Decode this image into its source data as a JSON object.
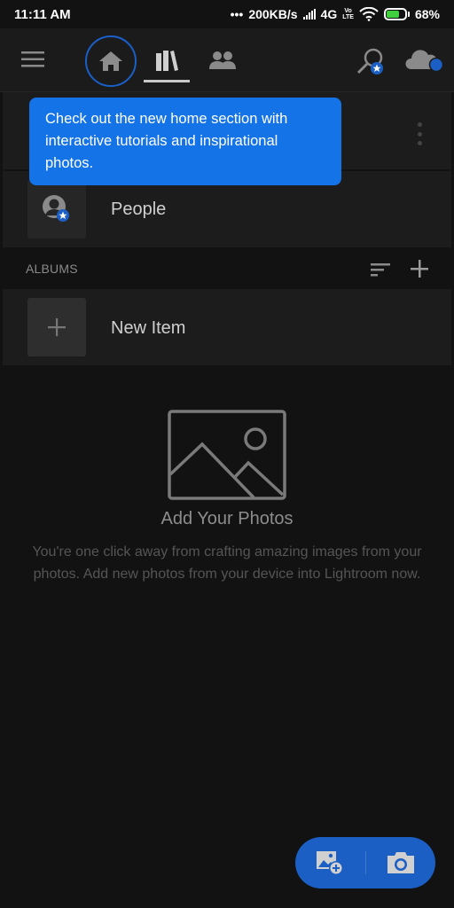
{
  "status_bar": {
    "time": "11:11 AM",
    "dots": "•••",
    "network_speed": "200KB/s",
    "network_type": "4G",
    "volte_top": "Vo",
    "volte_bottom": "LTE",
    "battery_percent": "68%",
    "battery_level": 0.68
  },
  "topbar": {
    "icons": [
      "menu-icon",
      "home-icon",
      "library-icon",
      "people-icon",
      "search-icon",
      "cloud-sync-icon"
    ],
    "active_tab": "library",
    "highlighted": "home"
  },
  "tooltip": {
    "text": "Check out the new home section with interactive tutorials and inspirational photos."
  },
  "rows": {
    "people_label": "People"
  },
  "albums": {
    "section_title": "ALBUMS",
    "new_item_label": "New Item"
  },
  "empty_state": {
    "title": "Add Your Photos",
    "description": "You're one click away from crafting amazing images from your photos. Add new photos from your device into Lightroom now."
  },
  "fab": {
    "actions": [
      "add-photos",
      "camera"
    ]
  },
  "colors": {
    "accent": "#1473e6",
    "fab": "#1b5fc4",
    "background": "#121212",
    "card": "#1c1c1c"
  }
}
